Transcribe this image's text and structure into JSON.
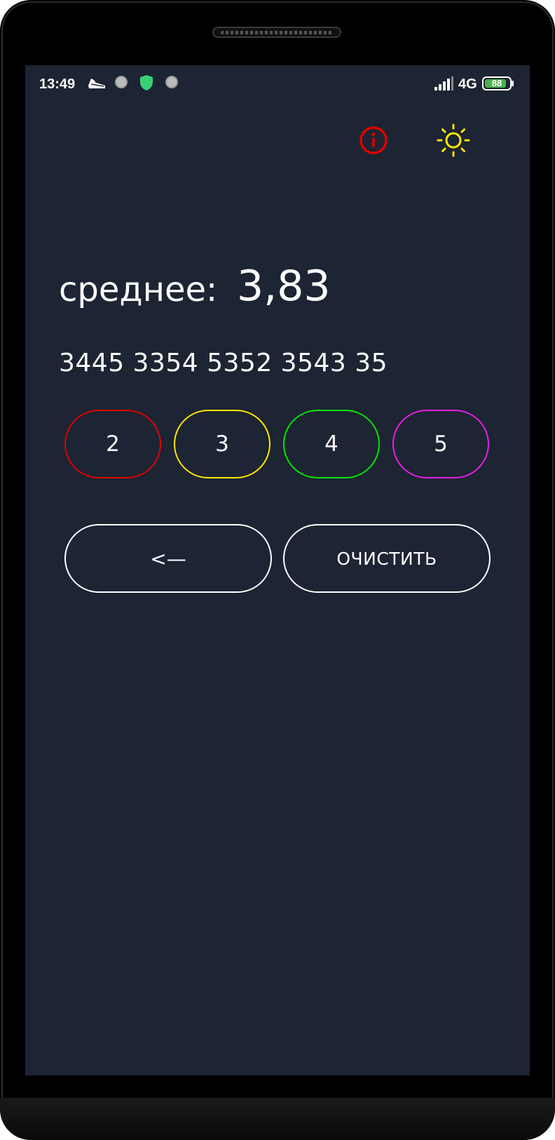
{
  "status_bar": {
    "time": "13:49",
    "network": "4G",
    "battery": "88",
    "battery_level": 0.88,
    "icons": [
      "running-shoe-icon",
      "notification-dot-icon",
      "shield-icon",
      "notification-dot-icon",
      "signal-icon",
      "battery-icon"
    ]
  },
  "toolbar": {
    "info_icon": "info-icon",
    "info_color": "#e00000",
    "theme_icon": "sun-icon",
    "theme_color": "#ffe600"
  },
  "average": {
    "label": "среднее:",
    "value": "3,83"
  },
  "grades_line": "3445 3354 5352 3543 35",
  "grade_buttons": [
    {
      "label": "2",
      "color": "#e00000"
    },
    {
      "label": "3",
      "color": "#ffe600"
    },
    {
      "label": "4",
      "color": "#00e600"
    },
    {
      "label": "5",
      "color": "#e61ee6"
    }
  ],
  "actions": {
    "back_label": "<—",
    "clear_label": "ОЧИСТИТЬ"
  },
  "colors": {
    "background": "#1d2433",
    "text": "#ffffff"
  }
}
